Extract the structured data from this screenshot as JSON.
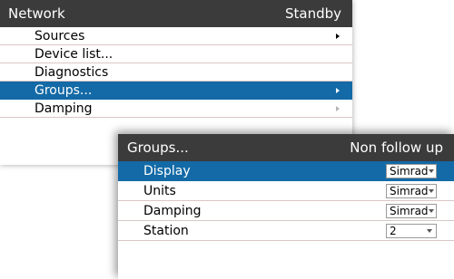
{
  "network_menu": {
    "title": "Network",
    "status": "Standby",
    "items": [
      {
        "label": "Sources",
        "has_submenu": true
      },
      {
        "label": "Device list...",
        "has_submenu": false
      },
      {
        "label": "Diagnostics",
        "has_submenu": false
      },
      {
        "label": "Groups...",
        "has_submenu": true,
        "selected": true
      },
      {
        "label": "Damping",
        "has_submenu": true
      }
    ]
  },
  "groups_dialog": {
    "title": "Groups...",
    "mode": "Non follow up",
    "rows": [
      {
        "label": "Display",
        "value": "Simrad",
        "selected": true
      },
      {
        "label": "Units",
        "value": "Simrad"
      },
      {
        "label": "Damping",
        "value": "Simrad"
      },
      {
        "label": "Station",
        "value": "2"
      }
    ]
  },
  "colors": {
    "title_bar": "#3b3b3b",
    "selection": "#136aa6",
    "row_divider": "#d9c6c6"
  }
}
